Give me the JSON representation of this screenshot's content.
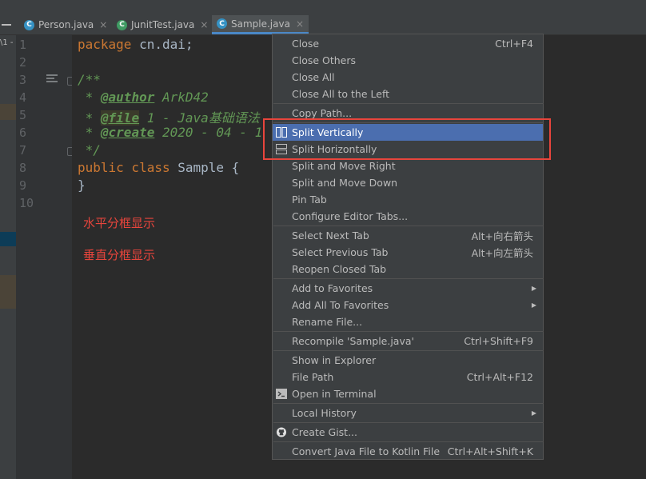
{
  "tabs": [
    {
      "name": "Person.java",
      "close": "×",
      "icon": "c-class-icon"
    },
    {
      "name": "JunitTest.java",
      "close": "×",
      "icon": "c-class-icon"
    },
    {
      "name": "Sample.java",
      "close": "×",
      "icon": "c-class-icon",
      "active": true
    }
  ],
  "left_strip_text": "\\1 -",
  "line_numbers": [
    "1",
    "2",
    "3",
    "4",
    "5",
    "6",
    "7",
    "8",
    "9",
    "10"
  ],
  "code": {
    "l1_kw": "package",
    "l1_rest": " cn.dai;",
    "l3": "/**",
    "l4_star": " * ",
    "l4_tag": "@author",
    "l4_rest": " ArkD42",
    "l5_star": " * ",
    "l5_tag": "@file",
    "l5_rest": " 1 - Java基础语法",
    "l6_star": " * ",
    "l6_tag": "@create",
    "l6_rest": " 2020 - 04 - 1",
    "l7": " */",
    "l8_kw": "public class",
    "l8_rest": " Sample {",
    "l9": "}"
  },
  "annotations": {
    "horizontal": "水平分框显示",
    "vertical": "垂直分框显示"
  },
  "menu": {
    "close": {
      "label": "Close",
      "shortcut": "Ctrl+F4"
    },
    "close_others": "Close Others",
    "close_all": "Close All",
    "close_all_left": "Close All to the Left",
    "copy_path": "Copy Path...",
    "split_vertically": "Split Vertically",
    "split_horizontally": "Split Horizontally",
    "split_move_right": "Split and Move Right",
    "split_move_down": "Split and Move Down",
    "pin_tab": "Pin Tab",
    "configure_tabs": "Configure Editor Tabs...",
    "select_next": {
      "label": "Select Next Tab",
      "shortcut": "Alt+向右箭头"
    },
    "select_prev": {
      "label": "Select Previous Tab",
      "shortcut": "Alt+向左箭头"
    },
    "reopen_closed": "Reopen Closed Tab",
    "add_favorites": "Add to Favorites",
    "add_all_favorites": "Add All To Favorites",
    "rename_file": "Rename File...",
    "recompile": {
      "label": "Recompile 'Sample.java'",
      "shortcut": "Ctrl+Shift+F9"
    },
    "show_explorer": "Show in Explorer",
    "file_path": {
      "label": "File Path",
      "shortcut": "Ctrl+Alt+F12"
    },
    "open_terminal": "Open in Terminal",
    "local_history": "Local History",
    "create_gist": "Create Gist...",
    "convert_kotlin": {
      "label": "Convert Java File to Kotlin File",
      "shortcut": "Ctrl+Alt+Shift+K"
    }
  },
  "colors": {
    "highlight": "#4b6eaf",
    "red_box": "#e8453c",
    "keyword": "#cc7832",
    "doc_comment": "#629755"
  }
}
